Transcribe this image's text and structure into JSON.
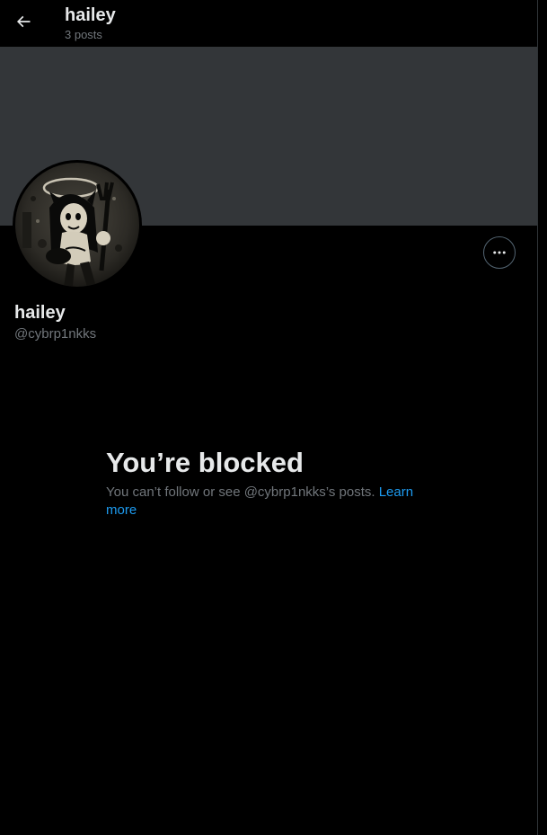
{
  "header": {
    "title": "hailey",
    "subtitle": "3 posts",
    "back_icon": "arrow-left-icon"
  },
  "profile": {
    "display_name": "hailey",
    "handle": "@cybrp1nkks",
    "more_icon": "more-horizontal-icon"
  },
  "blocked": {
    "title": "You’re blocked",
    "text": "You can’t follow or see @cybrp1nkks’s posts.",
    "link_label": "Learn more"
  },
  "colors": {
    "background": "#000000",
    "banner": "#333639",
    "text_primary": "#e7e9ea",
    "text_secondary": "#71767b",
    "link": "#1d9bf0",
    "border": "#2f3336"
  }
}
